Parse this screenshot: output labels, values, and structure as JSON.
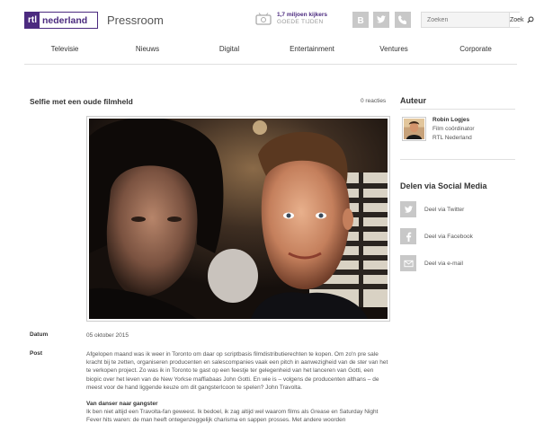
{
  "header": {
    "logo_rtl": "rtl",
    "logo_nederland": "nederland",
    "section_title": "Pressroom",
    "viewers_main": "1,7 miljoen kijkers",
    "viewers_sub": "GOEDE TIJDEN",
    "search_placeholder": "Zoeken",
    "search_button": "Zoek"
  },
  "social_icons": [
    "blogger-icon",
    "twitter-icon",
    "phone-icon"
  ],
  "nav": {
    "items": [
      "Televisie",
      "Nieuws",
      "Digital",
      "Entertainment",
      "Ventures",
      "Corporate"
    ]
  },
  "article": {
    "title": "Selfie met een oude filmheld",
    "reacties": "0 reacties",
    "datum_label": "Datum",
    "datum_value": "05 oktober 2015",
    "post_label": "Post",
    "paragraph1": "Afgelopen maand was ik weer in Toronto om daar op scriptbasis filmdistributierechten te kopen. Om zo'n pre sale kracht bij te zetten, organiseren producenten en salescompanies vaak een pitch in aanwezigheid van de ster van het te verkopen project. Zo was ik in Toronto te gast op een feestje ter gelegenheid van het lanceren van Gotti, een biopic over het leven van de New Yorkse maffiabaas John Gotti. En wie is – volgens de producenten althans – de meest voor de hand liggende keuze om dit gangsterIcoon te spelen? John Travolta.",
    "subhead": "Van danser naar gangster",
    "paragraph2": "Ik ben niet altijd een Travolta-fan geweest. Ik bedoel, ik zag altijd wel waarom films als Grease en Saturday Night Fever hits waren: de man heeft ontegenzeggelijk charisma en sappen prosses. Met andere woorden"
  },
  "sidebar": {
    "author_heading": "Auteur",
    "author_name": "Robin Logjes",
    "author_role": "Film coördinator",
    "author_company": "RTL Nederland",
    "share_heading": "Delen via Social Media",
    "share_items": [
      {
        "icon": "twitter-icon",
        "label": "Deel via Twitter"
      },
      {
        "icon": "facebook-icon",
        "label": "Deel via Facebook"
      },
      {
        "icon": "email-icon",
        "label": "Deel via e-mail"
      }
    ]
  },
  "colors": {
    "brand_purple": "#4b2a7f",
    "icon_grey": "#c8c8c8",
    "rule_grey": "#e0e0e0"
  }
}
